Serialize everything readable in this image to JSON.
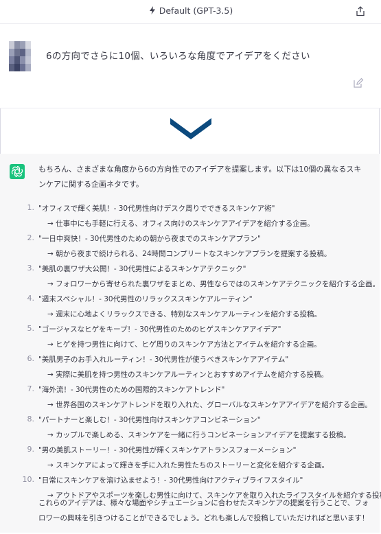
{
  "header": {
    "model_label": "Default (GPT-3.5)"
  },
  "user_message": {
    "text": "6の方向でさらに10個、いろいろな角度でアイデアをください"
  },
  "assistant_message": {
    "intro": "もちろん、さまざまな角度から6の方向性でのアイデアを提案します。以下は10個の異なるスキンケアに関する企画ネタです。",
    "items": [
      {
        "num": "1.",
        "title": "\"オフィスで輝く美肌！- 30代男性向けデスク周りでできるスキンケア術\"",
        "desc": "→ 仕事中にも手軽に行える、オフィス向けのスキンケアアイデアを紹介する企画。"
      },
      {
        "num": "2.",
        "title": "\"一日中爽快！- 30代男性のための朝から夜までのスキンケアプラン\"",
        "desc": "→ 朝から夜まで続けられる、24時間コンプリートなスキンケアプランを提案する投稿。"
      },
      {
        "num": "3.",
        "title": "\"美肌の裏ワザ大公開！- 30代男性によるスキンケアテクニック\"",
        "desc": "→ フォロワーから寄せられた裏ワザをまとめ、男性ならではのスキンケアテクニックを紹介する企画。"
      },
      {
        "num": "4.",
        "title": "\"週末スペシャル！- 30代男性のリラックススキンケアルーティン\"",
        "desc": "→ 週末に心地よくリラックスできる、特別なスキンケアルーティンを紹介する投稿。"
      },
      {
        "num": "5.",
        "title": "\"ゴージャスなヒゲをキープ！- 30代男性のためのヒゲスキンケアアイデア\"",
        "desc": "→ ヒゲを持つ男性に向けて、ヒゲ周りのスキンケア方法とアイテムを紹介する企画。"
      },
      {
        "num": "6.",
        "title": "\"美肌男子のお手入れルーティン！- 30代男性が使うべきスキンケアアイテム\"",
        "desc": "→ 実際に美肌を持つ男性のスキンケアルーティンとおすすめアイテムを紹介する投稿。"
      },
      {
        "num": "7.",
        "title": "\"海外流！- 30代男性のための国際的スキンケアトレンド\"",
        "desc": "→ 世界各国のスキンケアトレンドを取り入れた、グローバルなスキンケアアイデアを紹介する企画。"
      },
      {
        "num": "8.",
        "title": "\"パートナーと楽しむ！- 30代男性向けスキンケアコンビネーション\"",
        "desc": "→ カップルで楽しめる、スキンケアを一緒に行うコンビネーションアイデアを提案する投稿。"
      },
      {
        "num": "9.",
        "title": "\"男の美肌ストーリー！- 30代男性が輝くスキンケアトランスフォーメーション\"",
        "desc": "→ スキンケアによって輝きを手に入れた男性たちのストーリーと変化を紹介する企画。"
      },
      {
        "num": "10.",
        "title": "\"日常にスキンケアを溶け込ませよう！- 30代男性向けアクティブライフスタイル\"",
        "desc": "→ アウトドアやスポーツを楽しむ男性に向けて、スキンケアを取り入れたライフスタイルを紹介する投稿。"
      }
    ],
    "outro": "これらのアイデアは、様々な場面やシチュエーションに合わせたスキンケアの提案を行うことで、フォロワーの興味を引きつけることができるでしょう。どれも楽しんで投稿していただければと思います！"
  },
  "icons": {
    "model": "bolt-icon",
    "share": "share-icon",
    "edit": "edit-icon",
    "scroll": "chevron-down-icon",
    "assistant": "openai-logo-icon"
  },
  "colors": {
    "accent_arrow": "#0c4a7e",
    "assistant_logo_bg": "#19c37d",
    "assistant_bg": "#f7f7f8"
  }
}
